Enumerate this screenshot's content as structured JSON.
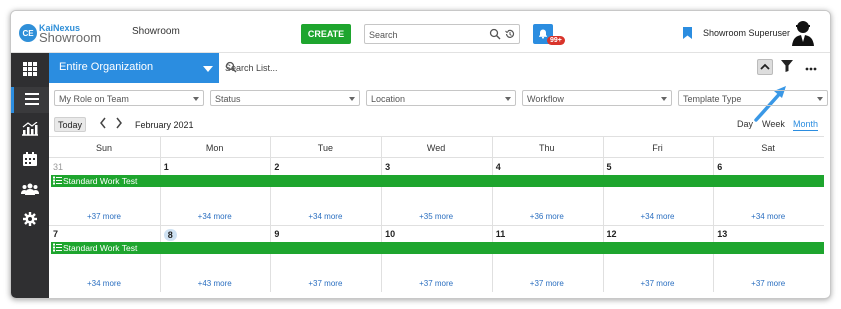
{
  "app": {
    "logo_top": "KaiNexus",
    "logo_bottom": "Showroom",
    "logo_mark": "CE",
    "site_name": "Showroom",
    "create_label": "CREATE",
    "search_placeholder": "Search",
    "notification_count": "99+",
    "user_name": "Showroom Superuser"
  },
  "toolbar": {
    "org_label": "Entire Organization",
    "list_search_placeholder": "Search List..."
  },
  "filters": [
    "My Role on Team",
    "Status",
    "Location",
    "Workflow",
    "Template Type"
  ],
  "calendar": {
    "today_label": "Today",
    "month": "February 2021",
    "views": [
      "Day",
      "Week",
      "Month"
    ],
    "active_view": "Month",
    "days": [
      "Sun",
      "Mon",
      "Tue",
      "Wed",
      "Thu",
      "Fri",
      "Sat"
    ],
    "weeks": [
      {
        "dates": [
          "31",
          "1",
          "2",
          "3",
          "4",
          "5",
          "6"
        ],
        "event": "Standard Work Test",
        "more": [
          "+37 more",
          "+34 more",
          "+34 more",
          "+35 more",
          "+36 more",
          "+34 more",
          "+34 more"
        ]
      },
      {
        "dates": [
          "7",
          "8",
          "9",
          "10",
          "11",
          "12",
          "13"
        ],
        "event": "Standard Work Test",
        "more": [
          "+34 more",
          "+43 more",
          "+37 more",
          "+37 more",
          "+37 more",
          "+37 more",
          "+37 more"
        ]
      }
    ]
  },
  "colors": {
    "accent": "#2b8de0",
    "create": "#1ea52e",
    "event": "#1ea52e",
    "nav_bg": "#2f2f31",
    "badge": "#d9342b"
  },
  "icons": {
    "nav": [
      "apps-grid-icon",
      "list-icon",
      "analytics-icon",
      "calendar-icon",
      "team-icon",
      "settings-icon"
    ],
    "other": [
      "search-icon",
      "history-icon",
      "bell-icon",
      "bookmark-icon",
      "user-avatar-icon",
      "collapse-up-icon",
      "filter-icon",
      "more-icon"
    ]
  }
}
